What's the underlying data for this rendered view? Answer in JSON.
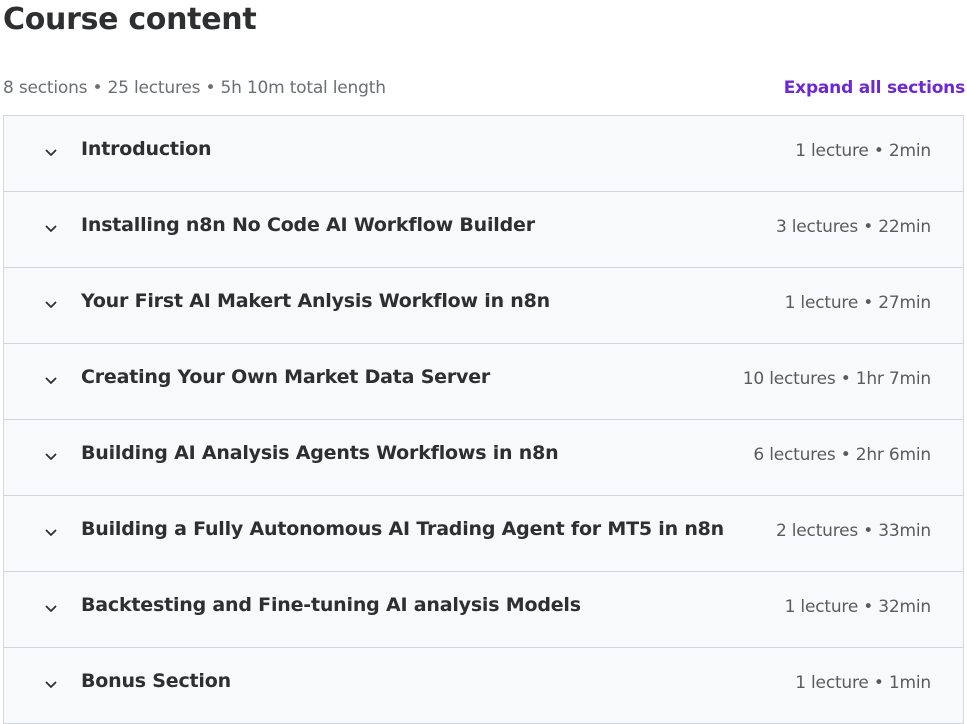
{
  "header": {
    "title": "Course content",
    "summary": "8 sections • 25 lectures • 5h 10m total length",
    "expand_label": "Expand all sections"
  },
  "icons": {
    "section_toggle": "chevron-down-icon"
  },
  "colors": {
    "accent": "#6d28d2",
    "section_bg": "#f7f9fa",
    "border": "#d1d7dc",
    "text": "#2d2f31"
  },
  "sections": [
    {
      "title": "Introduction",
      "meta": "1 lecture • 2min"
    },
    {
      "title": "Installing n8n No Code AI Workflow Builder",
      "meta": "3 lectures • 22min"
    },
    {
      "title": "Your First AI Makert Anlysis Workflow in n8n",
      "meta": "1 lecture • 27min"
    },
    {
      "title": "Creating Your Own Market Data Server",
      "meta": "10 lectures • 1hr 7min"
    },
    {
      "title": "Building AI Analysis Agents Workflows in n8n",
      "meta": "6 lectures • 2hr 6min"
    },
    {
      "title": "Building a Fully Autonomous AI Trading Agent for MT5 in n8n",
      "meta": "2 lectures • 33min"
    },
    {
      "title": "Backtesting and Fine-tuning AI analysis Models",
      "meta": "1 lecture • 32min"
    },
    {
      "title": "Bonus Section",
      "meta": "1 lecture • 1min"
    }
  ]
}
